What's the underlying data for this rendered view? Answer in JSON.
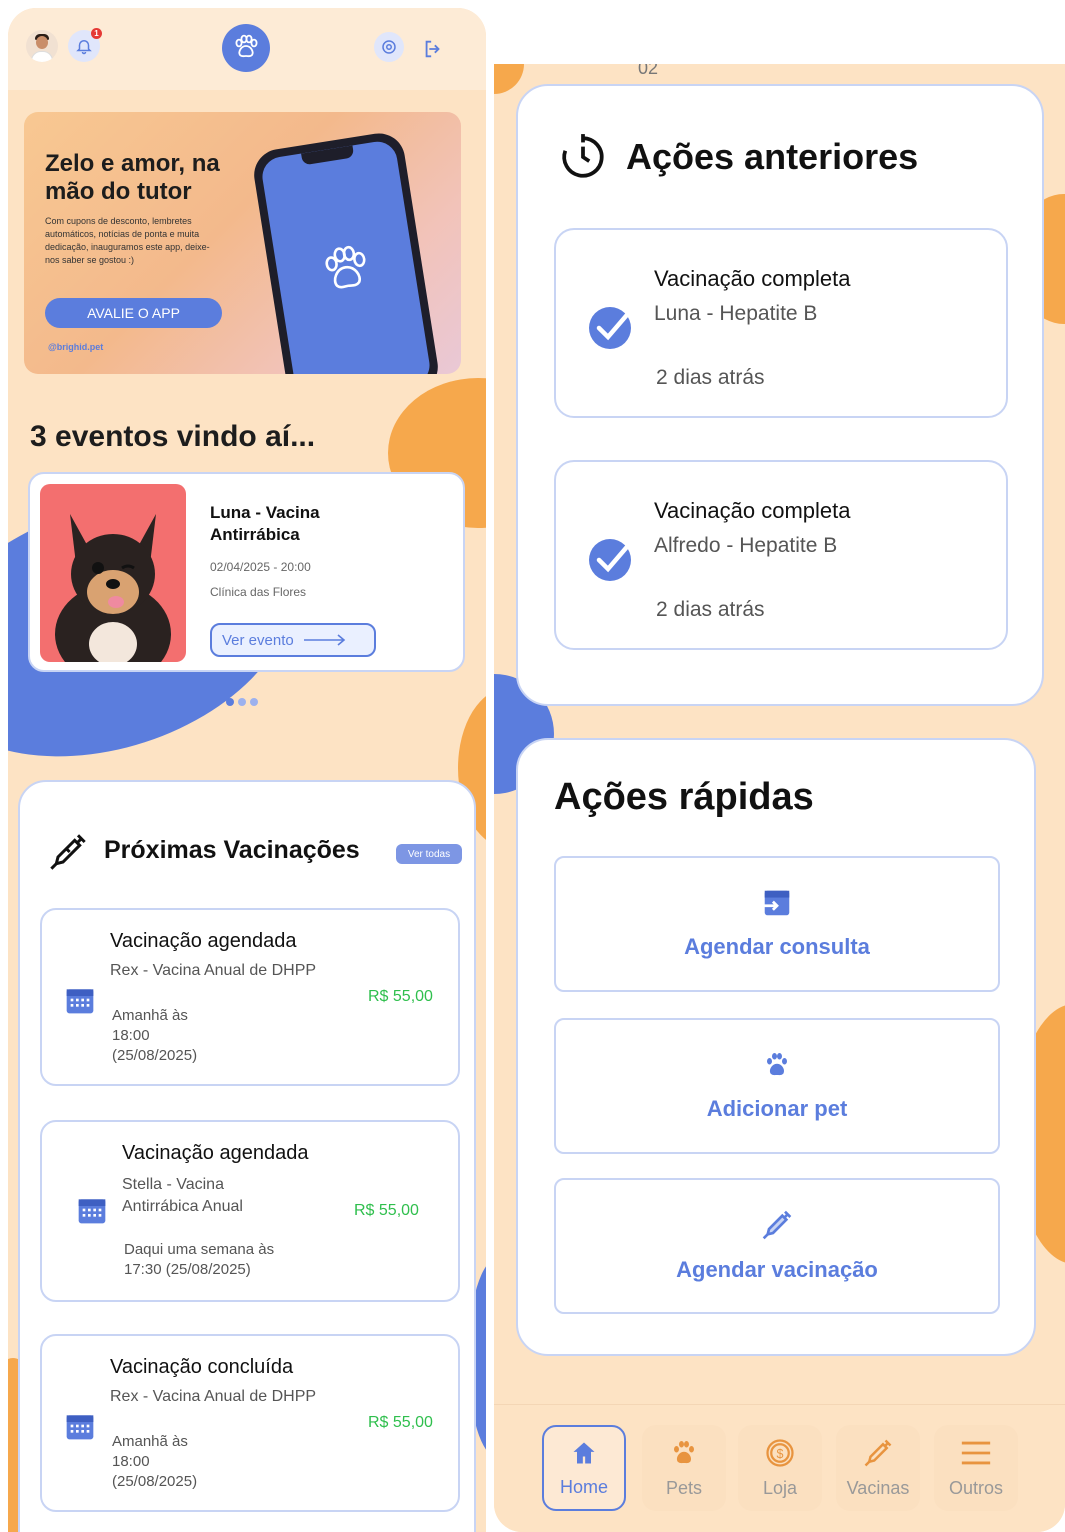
{
  "header": {
    "notification_count": "1"
  },
  "banner": {
    "title": "Zelo e amor, na mão do tutor",
    "text": "Com cupons de desconto, lembretes automáticos, notícias de ponta e muita dedicação, inauguramos este app, deixe-nos saber se gostou :)",
    "button_label": "AVALIE O APP",
    "handle": "@brighid.pet"
  },
  "events": {
    "title": "3 eventos vindo aí...",
    "card": {
      "name": "Luna - Vacina Antirrábica",
      "date": "02/04/2025 - 20:00",
      "place": "Clínica das Flores",
      "button_label": "Ver evento"
    },
    "pagination": {
      "total": 3,
      "active": 1
    }
  },
  "vaccinations": {
    "title": "Próximas Vacinações",
    "view_all_label": "Ver todas",
    "items": [
      {
        "title": "Vacinação agendada",
        "pet_vaccine": "Rex - Vacina Anual de DHPP",
        "price": "R$ 55,00",
        "when_1": "Amanhã às",
        "when_2": "18:00",
        "when_3": "(25/08/2025)"
      },
      {
        "title": "Vacinação agendada",
        "pet_vaccine_1": "Stella - Vacina",
        "pet_vaccine_2": "Antirrábica Anual",
        "price": "R$ 55,00",
        "when_1": "Daqui uma semana às",
        "when_2": "17:30 (25/08/2025)"
      },
      {
        "title": "Vacinação concluída",
        "pet_vaccine": "Rex - Vacina Anual de DHPP",
        "price": "R$ 55,00",
        "when_1": "Amanhã às",
        "when_2": "18:00",
        "when_3": "(25/08/2025)"
      }
    ]
  },
  "right_top_partial_text": "02",
  "past_actions": {
    "title": "Ações anteriores",
    "items": [
      {
        "title": "Vacinação completa",
        "subtitle": "Luna - Hepatite B",
        "when": "2 dias atrás"
      },
      {
        "title": "Vacinação completa",
        "subtitle": "Alfredo - Hepatite B",
        "when": "2 dias atrás"
      }
    ]
  },
  "quick_actions": {
    "title": "Ações rápidas",
    "items": [
      {
        "label": "Agendar consulta",
        "icon": "calendar-import-icon"
      },
      {
        "label": "Adicionar pet",
        "icon": "paw-icon"
      },
      {
        "label": "Agendar vacinação",
        "icon": "syringe-icon"
      }
    ]
  },
  "bottom_nav": {
    "items": [
      {
        "label": "Home",
        "icon": "home-icon",
        "active": true
      },
      {
        "label": "Pets",
        "icon": "paw-icon",
        "active": false
      },
      {
        "label": "Loja",
        "icon": "dollar-coin-icon",
        "active": false
      },
      {
        "label": "Vacinas",
        "icon": "syringe-icon",
        "active": false
      },
      {
        "label": "Outros",
        "icon": "menu-icon",
        "active": false
      }
    ]
  },
  "colors": {
    "brand_blue": "#5b7ddd",
    "background_peach": "#fde3c4",
    "accent_orange": "#f6a84c",
    "price_green": "#2fbf4d",
    "card_border": "#c8d4f4"
  }
}
